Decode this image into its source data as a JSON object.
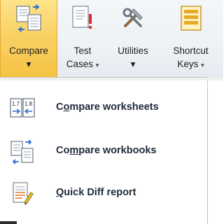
{
  "ribbon": {
    "compare": {
      "label": "Compare",
      "icon": "compare-files-icon"
    },
    "test_cases": {
      "line1": "Test",
      "line2": "Cases",
      "icon": "test-cases-icon"
    },
    "utilities": {
      "label": "Utilities",
      "icon": "tools-icon"
    },
    "shortcut_keys": {
      "line1": "Shortcut",
      "line2": "Keys",
      "icon": "shortcut-keys-icon"
    },
    "dropdown_glyph": "▾"
  },
  "menu": {
    "items": [
      {
        "label_pre": "C",
        "label_accel": "o",
        "label_post": "mpare worksheets",
        "icon": "compare-worksheets-icon"
      },
      {
        "label_pre": "Co",
        "label_accel": "m",
        "label_post": "pare workbooks",
        "icon": "compare-workbooks-icon"
      },
      {
        "label_pre": "",
        "label_accel": "Q",
        "label_post": "uick Diff report",
        "icon": "quick-diff-report-icon"
      }
    ]
  },
  "colors": {
    "compare_active_bg": "#f9d265",
    "ribbon_bg": "#eef1f5",
    "menu_bg": "#ffffff"
  }
}
